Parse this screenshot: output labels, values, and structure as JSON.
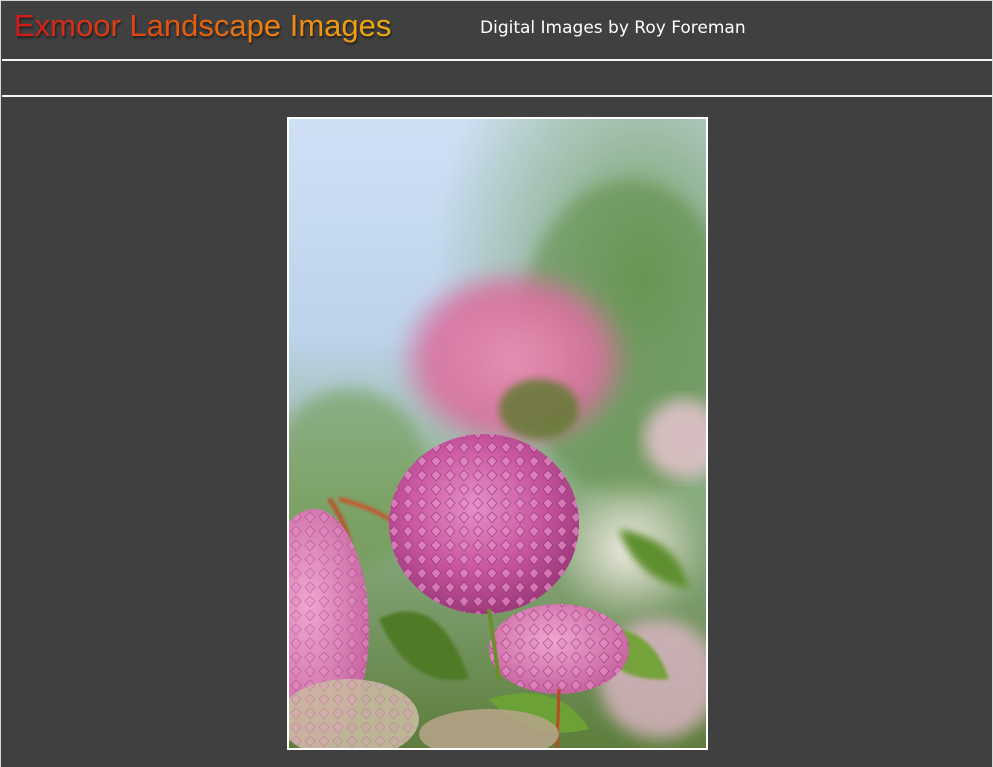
{
  "header": {
    "title": "Exmoor Landscape Images",
    "subtitle": "Digital Images by Roy Foreman"
  },
  "photo": {
    "subject_icon": "hydrangea-photo"
  },
  "colors": {
    "background": "#404040",
    "title_gradient_start": "#d2171b",
    "title_gradient_end": "#f2ad10",
    "rule": "#f4f4f4",
    "photo_border": "#ffffff"
  }
}
